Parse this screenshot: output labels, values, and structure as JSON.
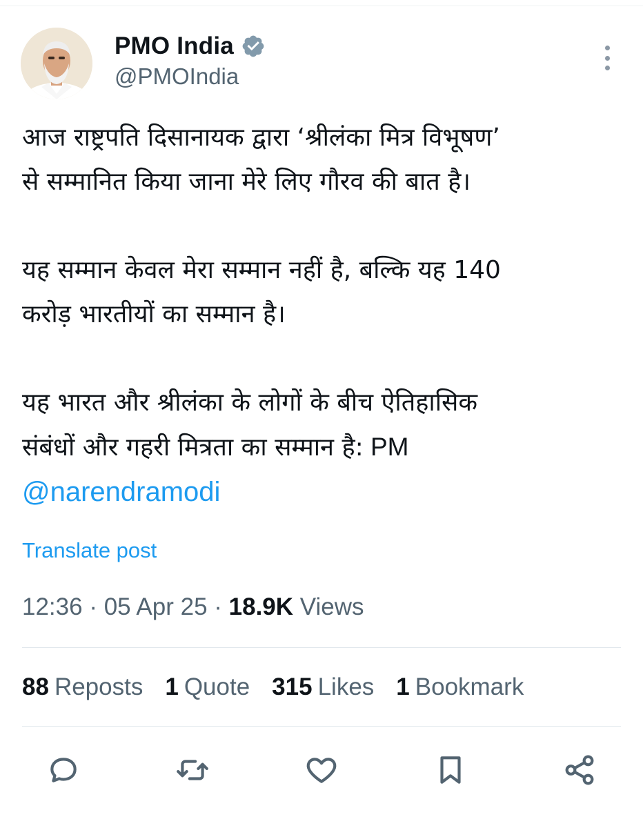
{
  "author": {
    "name": "PMO India",
    "handle": "@PMOIndia",
    "verified_color": "#829aab"
  },
  "tweet": {
    "paragraphs": [
      {
        "lines": [
          "आज राष्ट्रपति दिसानायक द्वारा ‘श्रीलंका मित्र विभूषण’",
          "से सम्मानित किया जाना मेरे लिए गौरव की बात है।"
        ]
      },
      {
        "lines": [
          "यह सम्मान केवल मेरा सम्मान नहीं है, बल्कि यह 140",
          "करोड़ भारतीयों का सम्मान है।"
        ]
      },
      {
        "lines": [
          "यह भारत और श्रीलंका के लोगों के बीच ऐतिहासिक",
          "संबंधों और गहरी मित्रता का सम्मान है:"
        ],
        "suffix": " PM",
        "mention": "@narendramodi"
      }
    ],
    "translate_label": "Translate post",
    "time": "12:36",
    "date": "05 Apr 25",
    "separator": " · ",
    "views_count": "18.9K",
    "views_label": " Views"
  },
  "stats": {
    "reposts": {
      "count": "88",
      "label": "Reposts"
    },
    "quotes": {
      "count": "1",
      "label": "Quote"
    },
    "likes": {
      "count": "315",
      "label": "Likes"
    },
    "bookmarks": {
      "count": "1",
      "label": "Bookmark"
    }
  },
  "actions": [
    "reply-icon",
    "repost-icon",
    "like-icon",
    "bookmark-icon",
    "share-icon"
  ],
  "colors": {
    "accent": "#1d9bf0",
    "secondary_text": "#536471",
    "primary_text": "#0f1419",
    "icon": "#536471"
  }
}
